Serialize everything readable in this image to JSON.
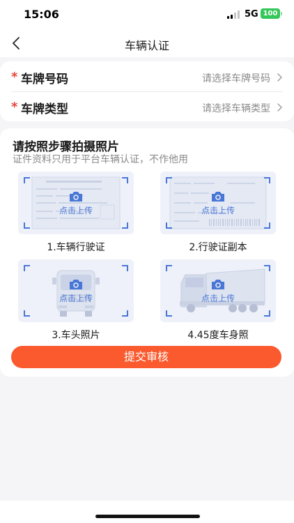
{
  "status_bar": {
    "time": "15:06",
    "network": "5G",
    "battery": "100"
  },
  "nav": {
    "title": "车辆认证"
  },
  "form": {
    "rows": [
      {
        "label": "车牌号码",
        "value": "请选择车牌号码"
      },
      {
        "label": "车牌类型",
        "value": "请选择车辆类型"
      }
    ]
  },
  "photos": {
    "title": "请按照步骤拍摄照片",
    "subtitle": "证件资料只用于平台车辆认证，不作他用",
    "slots": [
      {
        "upload_text": "点击上传",
        "label": "1.车辆行驶证"
      },
      {
        "upload_text": "点击上传",
        "label": "2.行驶证副本"
      },
      {
        "upload_text": "点击上传",
        "label": "3.车头照片"
      },
      {
        "upload_text": "点击上传",
        "label": "4.45度车身照"
      }
    ]
  },
  "submit": {
    "label": "提交审核"
  },
  "colors": {
    "accent": "#fa5a2e",
    "link_blue": "#4a77d6",
    "required": "#e8443a"
  }
}
